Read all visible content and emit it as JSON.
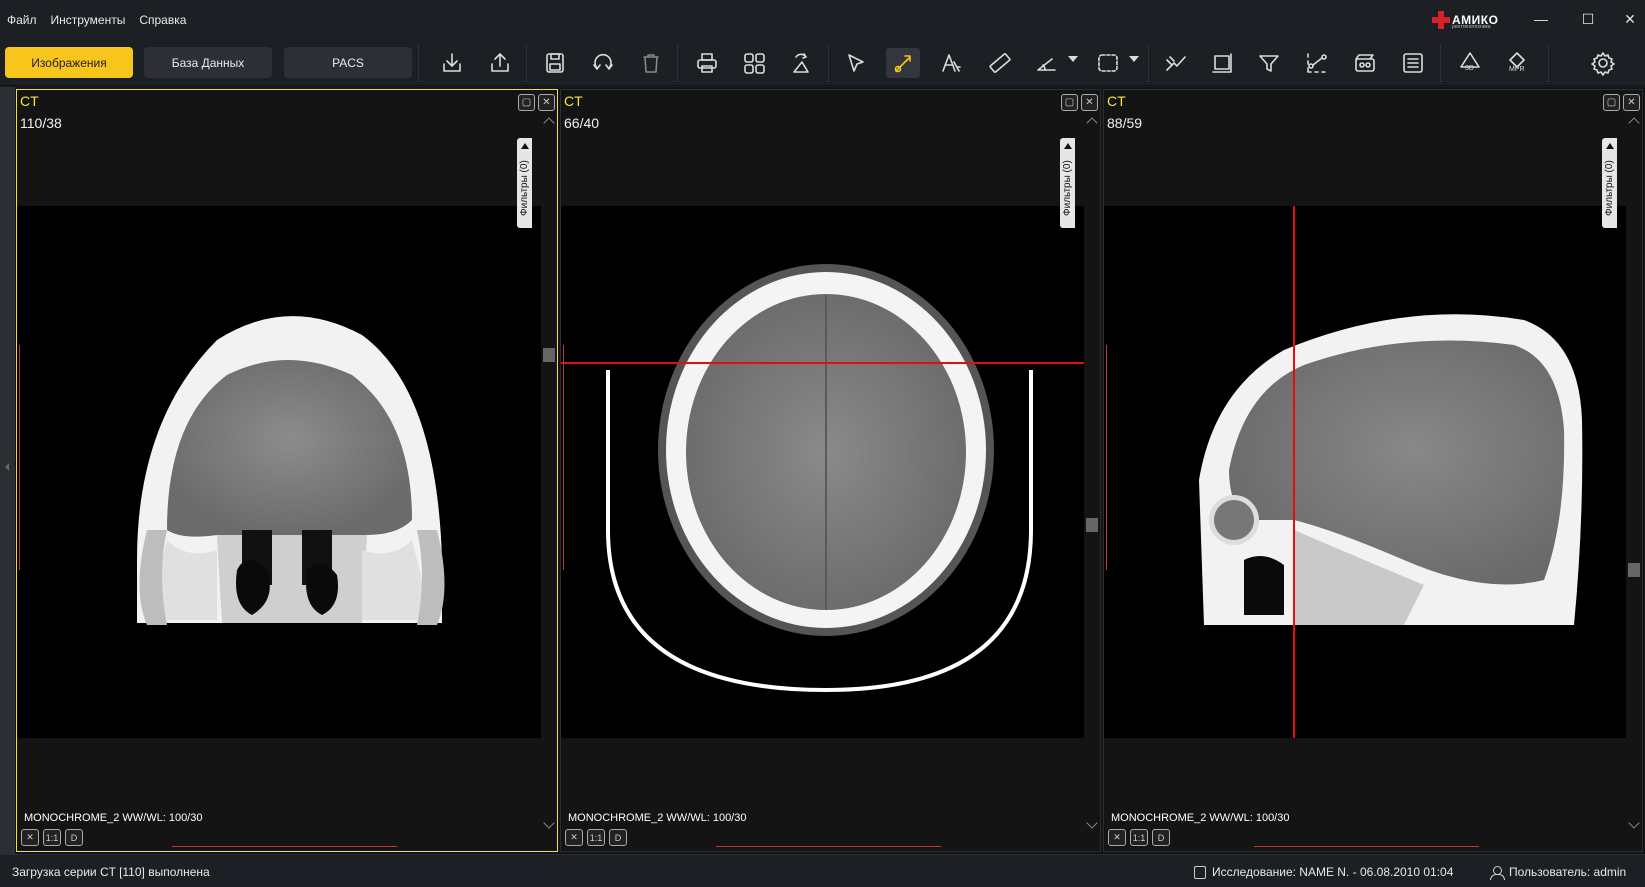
{
  "menu": {
    "file": "Файл",
    "tools": "Инструменты",
    "help": "Справка"
  },
  "logo": {
    "name": "АМИКО",
    "sub": "рентгенотехника"
  },
  "window": {
    "minimize": "—",
    "maximize": "☐",
    "close": "✕"
  },
  "tabs": {
    "images": "Изображения",
    "database": "База Данных",
    "pacs": "PACS"
  },
  "tools": [
    "import",
    "export",
    "save",
    "rotate",
    "delete",
    "print",
    "layout",
    "flip",
    "select",
    "window-level",
    "annotate-text",
    "ruler",
    "angle",
    "roi-select",
    "presets",
    "crop",
    "filter",
    "curve",
    "cine",
    "report",
    "3d",
    "mpr",
    "settings"
  ],
  "tool_labels": {
    "three_d": "3D",
    "mpr": "MPR"
  },
  "viewports": [
    {
      "modality": "CT",
      "slice": "110/38",
      "wwwl": "MONOCHROME_2 WW/WL: 100/30",
      "filters": "Фильтры (0)",
      "orientation": "coronal",
      "active": true
    },
    {
      "modality": "CT",
      "slice": "66/40",
      "wwwl": "MONOCHROME_2 WW/WL: 100/30",
      "filters": "Фильтры (0)",
      "orientation": "axial",
      "active": false
    },
    {
      "modality": "CT",
      "slice": "88/59",
      "wwwl": "MONOCHROME_2 WW/WL: 100/30",
      "filters": "Фильтры (0)",
      "orientation": "sagittal",
      "active": false
    }
  ],
  "viewport_buttons": {
    "fit": "1:1",
    "d": "D"
  },
  "status": {
    "message": "Загрузка серии CT [110] выполнена",
    "study": "Исследование: NAME N. - 06.08.2010 01:04",
    "user": "Пользователь: admin"
  },
  "colors": {
    "accent": "#f7c51c",
    "active_border": "#f0e32a",
    "crosshair": "#e01010",
    "ruler": "#c0392b"
  }
}
